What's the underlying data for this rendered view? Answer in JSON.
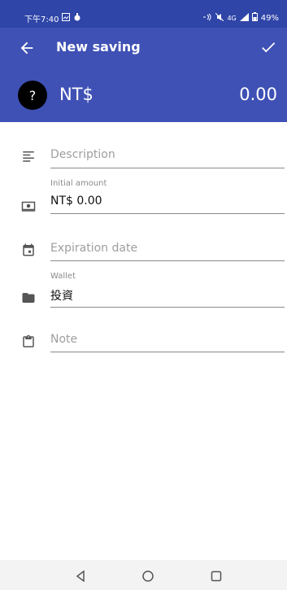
{
  "status": {
    "time": "下午7:40",
    "battery": "49%",
    "network": "4G"
  },
  "appbar": {
    "title": "New saving"
  },
  "header": {
    "avatar_symbol": "?",
    "currency": "NT$",
    "amount": "0.00"
  },
  "form": {
    "description_placeholder": "Description",
    "initial_amount_label": "Initial amount",
    "initial_amount_value": "NT$ 0.00",
    "expiration_placeholder": "Expiration date",
    "wallet_label": "Wallet",
    "wallet_value": "投資",
    "note_placeholder": "Note"
  },
  "icons": {
    "description": "text-lines-icon",
    "amount": "money-icon",
    "expiration": "calendar-icon",
    "wallet": "folder-icon",
    "note": "clipboard-icon"
  },
  "colors": {
    "primary": "#3f51b5",
    "status_bar": "#2f45a8"
  }
}
